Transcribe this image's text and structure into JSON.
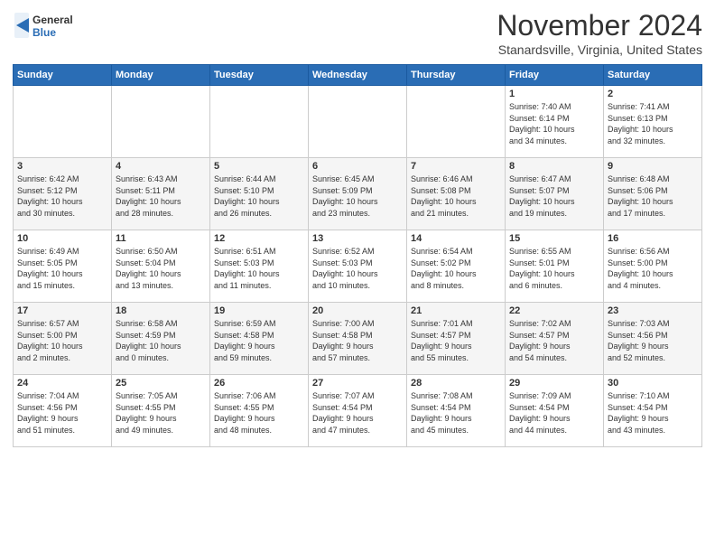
{
  "logo": {
    "general": "General",
    "blue": "Blue"
  },
  "header": {
    "month": "November 2024",
    "location": "Stanardsville, Virginia, United States"
  },
  "days_of_week": [
    "Sunday",
    "Monday",
    "Tuesday",
    "Wednesday",
    "Thursday",
    "Friday",
    "Saturday"
  ],
  "weeks": [
    [
      {
        "day": "",
        "info": ""
      },
      {
        "day": "",
        "info": ""
      },
      {
        "day": "",
        "info": ""
      },
      {
        "day": "",
        "info": ""
      },
      {
        "day": "",
        "info": ""
      },
      {
        "day": "1",
        "info": "Sunrise: 7:40 AM\nSunset: 6:14 PM\nDaylight: 10 hours\nand 34 minutes."
      },
      {
        "day": "2",
        "info": "Sunrise: 7:41 AM\nSunset: 6:13 PM\nDaylight: 10 hours\nand 32 minutes."
      }
    ],
    [
      {
        "day": "3",
        "info": "Sunrise: 6:42 AM\nSunset: 5:12 PM\nDaylight: 10 hours\nand 30 minutes."
      },
      {
        "day": "4",
        "info": "Sunrise: 6:43 AM\nSunset: 5:11 PM\nDaylight: 10 hours\nand 28 minutes."
      },
      {
        "day": "5",
        "info": "Sunrise: 6:44 AM\nSunset: 5:10 PM\nDaylight: 10 hours\nand 26 minutes."
      },
      {
        "day": "6",
        "info": "Sunrise: 6:45 AM\nSunset: 5:09 PM\nDaylight: 10 hours\nand 23 minutes."
      },
      {
        "day": "7",
        "info": "Sunrise: 6:46 AM\nSunset: 5:08 PM\nDaylight: 10 hours\nand 21 minutes."
      },
      {
        "day": "8",
        "info": "Sunrise: 6:47 AM\nSunset: 5:07 PM\nDaylight: 10 hours\nand 19 minutes."
      },
      {
        "day": "9",
        "info": "Sunrise: 6:48 AM\nSunset: 5:06 PM\nDaylight: 10 hours\nand 17 minutes."
      }
    ],
    [
      {
        "day": "10",
        "info": "Sunrise: 6:49 AM\nSunset: 5:05 PM\nDaylight: 10 hours\nand 15 minutes."
      },
      {
        "day": "11",
        "info": "Sunrise: 6:50 AM\nSunset: 5:04 PM\nDaylight: 10 hours\nand 13 minutes."
      },
      {
        "day": "12",
        "info": "Sunrise: 6:51 AM\nSunset: 5:03 PM\nDaylight: 10 hours\nand 11 minutes."
      },
      {
        "day": "13",
        "info": "Sunrise: 6:52 AM\nSunset: 5:03 PM\nDaylight: 10 hours\nand 10 minutes."
      },
      {
        "day": "14",
        "info": "Sunrise: 6:54 AM\nSunset: 5:02 PM\nDaylight: 10 hours\nand 8 minutes."
      },
      {
        "day": "15",
        "info": "Sunrise: 6:55 AM\nSunset: 5:01 PM\nDaylight: 10 hours\nand 6 minutes."
      },
      {
        "day": "16",
        "info": "Sunrise: 6:56 AM\nSunset: 5:00 PM\nDaylight: 10 hours\nand 4 minutes."
      }
    ],
    [
      {
        "day": "17",
        "info": "Sunrise: 6:57 AM\nSunset: 5:00 PM\nDaylight: 10 hours\nand 2 minutes."
      },
      {
        "day": "18",
        "info": "Sunrise: 6:58 AM\nSunset: 4:59 PM\nDaylight: 10 hours\nand 0 minutes."
      },
      {
        "day": "19",
        "info": "Sunrise: 6:59 AM\nSunset: 4:58 PM\nDaylight: 9 hours\nand 59 minutes."
      },
      {
        "day": "20",
        "info": "Sunrise: 7:00 AM\nSunset: 4:58 PM\nDaylight: 9 hours\nand 57 minutes."
      },
      {
        "day": "21",
        "info": "Sunrise: 7:01 AM\nSunset: 4:57 PM\nDaylight: 9 hours\nand 55 minutes."
      },
      {
        "day": "22",
        "info": "Sunrise: 7:02 AM\nSunset: 4:57 PM\nDaylight: 9 hours\nand 54 minutes."
      },
      {
        "day": "23",
        "info": "Sunrise: 7:03 AM\nSunset: 4:56 PM\nDaylight: 9 hours\nand 52 minutes."
      }
    ],
    [
      {
        "day": "24",
        "info": "Sunrise: 7:04 AM\nSunset: 4:56 PM\nDaylight: 9 hours\nand 51 minutes."
      },
      {
        "day": "25",
        "info": "Sunrise: 7:05 AM\nSunset: 4:55 PM\nDaylight: 9 hours\nand 49 minutes."
      },
      {
        "day": "26",
        "info": "Sunrise: 7:06 AM\nSunset: 4:55 PM\nDaylight: 9 hours\nand 48 minutes."
      },
      {
        "day": "27",
        "info": "Sunrise: 7:07 AM\nSunset: 4:54 PM\nDaylight: 9 hours\nand 47 minutes."
      },
      {
        "day": "28",
        "info": "Sunrise: 7:08 AM\nSunset: 4:54 PM\nDaylight: 9 hours\nand 45 minutes."
      },
      {
        "day": "29",
        "info": "Sunrise: 7:09 AM\nSunset: 4:54 PM\nDaylight: 9 hours\nand 44 minutes."
      },
      {
        "day": "30",
        "info": "Sunrise: 7:10 AM\nSunset: 4:54 PM\nDaylight: 9 hours\nand 43 minutes."
      }
    ]
  ]
}
